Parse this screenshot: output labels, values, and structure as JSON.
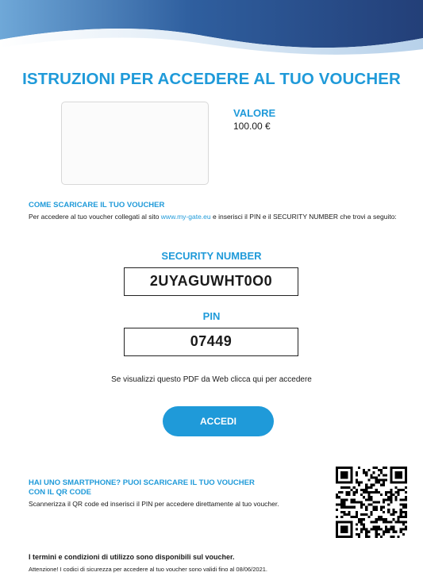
{
  "document": {
    "title": "ISTRUZIONI PER ACCEDERE AL TUO VOUCHER",
    "value": {
      "label": "VALORE",
      "amount": "100.00 €"
    },
    "howto": {
      "title": "COME SCARICARE IL TUO VOUCHER",
      "text_before": "Per accedere al tuo voucher collegati al sito ",
      "link": "www.my-gate.eu",
      "text_after": " e inserisci il PIN e il SECURITY NUMBER che trovi a seguito:"
    },
    "security": {
      "label": "SECURITY NUMBER",
      "code": "2UYAGUWHT0O0"
    },
    "pin": {
      "label": "PIN",
      "code": "07449"
    },
    "pdf_note": "Se visualizzi questo PDF da Web clicca qui per accedere",
    "accedi_label": "ACCEDI",
    "qr": {
      "title": "HAI UNO SMARTPHONE? PUOI SCARICARE IL TUO VOUCHER CON IL QR CODE",
      "text": "Scannerizza il QR code ed inserisci il PIN per accedere direttamente al tuo voucher."
    },
    "terms": "I termini e condizioni di utilizzo sono disponibili sul voucher.",
    "warning": "Attenzione! I codici di sicurezza per accedere al tuo voucher sono validi fino al 08/06/2021."
  },
  "colors": {
    "accent": "#1f9ad9",
    "header_dark": "#2c4f8c",
    "header_light": "#7fb6e0"
  },
  "icons": {
    "header": "wave-banner",
    "qr": "qr-code-icon"
  }
}
